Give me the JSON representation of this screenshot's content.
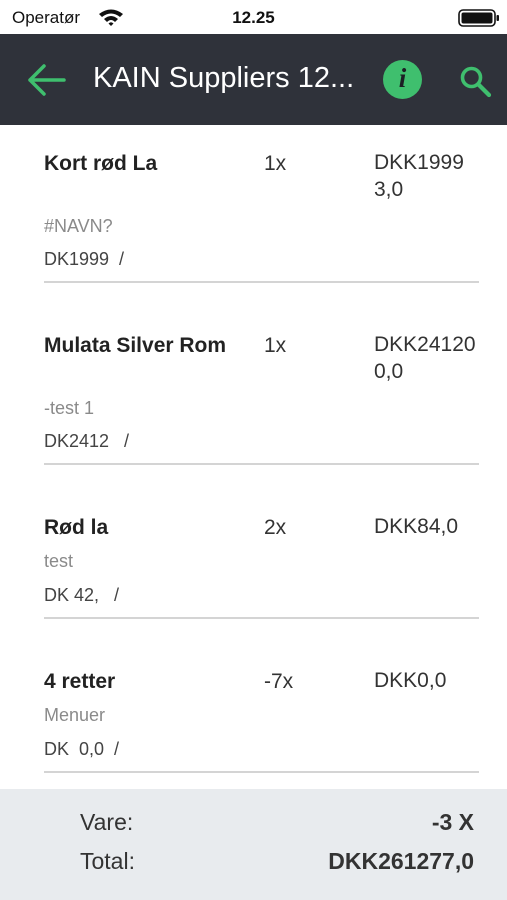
{
  "status_bar": {
    "carrier": "Operatør",
    "time": "12.25"
  },
  "app_bar": {
    "title": "KAIN Suppliers 12...",
    "info_label": "i",
    "accent_color": "#3fbf6e",
    "background_color": "#2f323a"
  },
  "items": [
    {
      "name": "Kort rød La",
      "qty": "1x",
      "price": "DKK19993,0",
      "desc": "#NAVN?",
      "code": "DK1999  /"
    },
    {
      "name": "Mulata Silver Rom",
      "qty": "1x",
      "price": "DKK241200,0",
      "desc": "-test 1",
      "code": "DK2412   /"
    },
    {
      "name": "Rød la",
      "qty": "2x",
      "price": "DKK84,0",
      "desc": "test",
      "code": "DK 42,   /"
    },
    {
      "name": "4 retter",
      "qty": "-7x",
      "price": "DKK0,0",
      "desc": "Menuer",
      "code": "DK  0,0  /"
    }
  ],
  "summary": {
    "items_label": "Vare:",
    "items_value": "-3 X",
    "total_label": "Total:",
    "total_value": "DKK261277,0"
  }
}
